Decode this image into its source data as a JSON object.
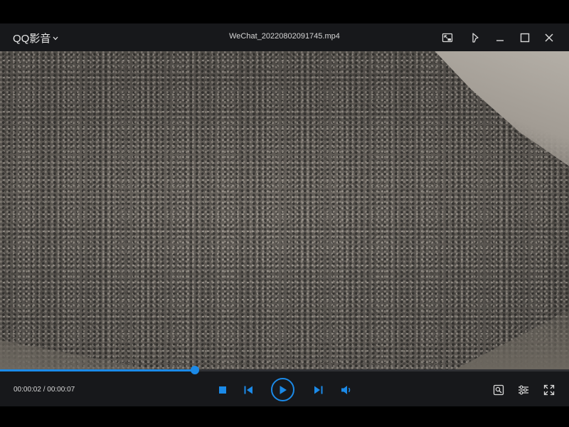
{
  "titlebar": {
    "app_name": "QQ影音",
    "file_name": "WeChat_20220802091745.mp4"
  },
  "playback": {
    "current_time": "00:00:02",
    "separator": " / ",
    "duration": "00:00:07",
    "progress_fraction": 0.343
  },
  "colors": {
    "accent": "#1b8ae8",
    "chrome": "#17181b"
  },
  "icons": {
    "app_menu": "chevron-down-icon",
    "mini_mode": "picture-in-picture-icon",
    "pin": "pin-icon",
    "minimize": "minimize-icon",
    "maximize": "maximize-icon",
    "close": "close-icon",
    "stop": "stop-icon",
    "prev": "previous-icon",
    "play": "play-icon",
    "next": "next-icon",
    "volume": "volume-icon",
    "screenshot": "screenshot-icon",
    "settings": "settings-sliders-icon",
    "fullscreen": "fullscreen-icon"
  }
}
